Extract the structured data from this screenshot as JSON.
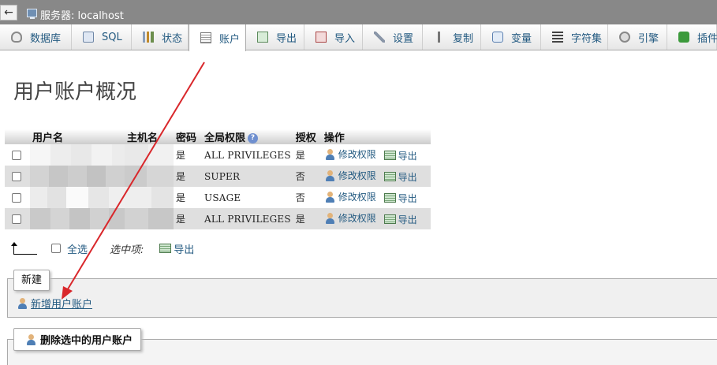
{
  "titlebar": {
    "back_icon": "←",
    "server_label": "服务器: localhost"
  },
  "tabs": [
    {
      "label": "数据库",
      "icon": "database-icon"
    },
    {
      "label": "SQL",
      "icon": "sql-icon"
    },
    {
      "label": "状态",
      "icon": "status-icon"
    },
    {
      "label": "账户",
      "icon": "user-accounts-icon",
      "active": true
    },
    {
      "label": "导出",
      "icon": "export-icon"
    },
    {
      "label": "导入",
      "icon": "import-icon"
    },
    {
      "label": "设置",
      "icon": "settings-icon"
    },
    {
      "label": "复制",
      "icon": "replication-icon"
    },
    {
      "label": "变量",
      "icon": "variables-icon"
    },
    {
      "label": "字符集",
      "icon": "charset-icon"
    },
    {
      "label": "引擎",
      "icon": "engine-icon"
    },
    {
      "label": "插件",
      "icon": "plugins-icon"
    }
  ],
  "page": {
    "title": "用户账户概况"
  },
  "table": {
    "headers": {
      "username": "用户名",
      "host": "主机名",
      "password": "密码",
      "global_privileges": "全局权限",
      "grant": "授权",
      "action": "操作"
    },
    "help_icon": "?",
    "rows": [
      {
        "password": "是",
        "privileges": "ALL PRIVILEGES",
        "grant": "是",
        "edit": "修改权限",
        "export": "导出"
      },
      {
        "password": "是",
        "privileges": "SUPER",
        "grant": "否",
        "edit": "修改权限",
        "export": "导出"
      },
      {
        "password": "是",
        "privileges": "USAGE",
        "grant": "否",
        "edit": "修改权限",
        "export": "导出"
      },
      {
        "password": "是",
        "privileges": "ALL PRIVILEGES",
        "grant": "是",
        "edit": "修改权限",
        "export": "导出"
      }
    ]
  },
  "bulk": {
    "select_all": "全选",
    "with_selected": "选中项:",
    "export": "导出"
  },
  "new_section": {
    "legend": "新建",
    "add_user": "新增用户账户"
  },
  "delete_button": "删除选中的用户账户",
  "colors": {
    "link": "#235a81",
    "annotation_arrow": "#d9272b",
    "topbar": "#888888"
  }
}
